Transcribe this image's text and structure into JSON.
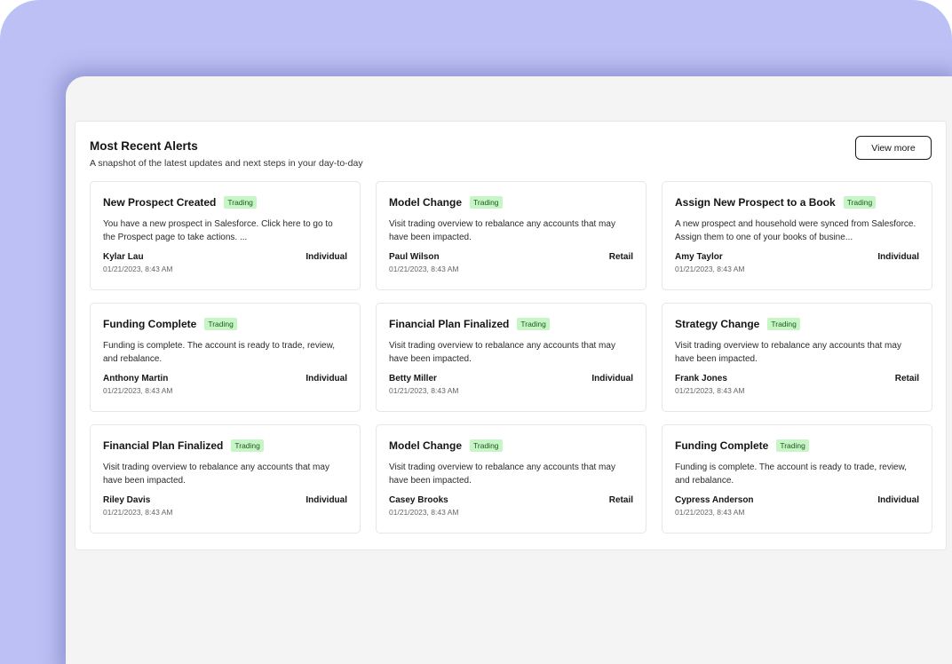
{
  "alerts_panel": {
    "title": "Most Recent Alerts",
    "subtitle": "A snapshot of the latest updates and next steps in your day-to-day",
    "view_more_label": "View more",
    "cards": [
      {
        "title": "New Prospect Created",
        "badge": "Trading",
        "description": "You have a new prospect in Salesforce. Click here to go to the Prospect page to take actions. ...",
        "name": "Kylar Lau",
        "type": "Individual",
        "date": "01/21/2023, 8:43 AM"
      },
      {
        "title": "Model Change",
        "badge": "Trading",
        "description": "Visit trading overview to rebalance any accounts that may have been impacted.",
        "name": "Paul Wilson",
        "type": "Retail",
        "date": "01/21/2023, 8:43 AM"
      },
      {
        "title": "Assign New Prospect to a Book",
        "badge": "Trading",
        "description": "A new prospect and household were synced from Salesforce. Assign them to one of your books of busine...",
        "name": "Amy Taylor",
        "type": "Individual",
        "date": "01/21/2023, 8:43 AM"
      },
      {
        "title": "Funding Complete",
        "badge": "Trading",
        "description": "Funding is complete. The account is ready to trade, review, and rebalance.",
        "name": "Anthony Martin",
        "type": "Individual",
        "date": "01/21/2023, 8:43 AM"
      },
      {
        "title": "Financial Plan Finalized",
        "badge": "Trading",
        "description": "Visit trading overview to rebalance any accounts that may have been impacted.",
        "name": "Betty Miller",
        "type": "Individual",
        "date": "01/21/2023, 8:43 AM"
      },
      {
        "title": "Strategy Change",
        "badge": "Trading",
        "description": "Visit trading overview to rebalance any accounts that may have been impacted.",
        "name": "Frank Jones",
        "type": "Retail",
        "date": "01/21/2023, 8:43 AM"
      },
      {
        "title": "Financial Plan Finalized",
        "badge": "Trading",
        "description": "Visit trading overview to rebalance any accounts that may have been impacted.",
        "name": "Riley Davis",
        "type": "Individual",
        "date": "01/21/2023, 8:43 AM"
      },
      {
        "title": "Model Change",
        "badge": "Trading",
        "description": "Visit trading overview to rebalance any accounts that may have been impacted.",
        "name": "Casey Brooks",
        "type": "Retail",
        "date": "01/21/2023, 8:43 AM"
      },
      {
        "title": "Funding Complete",
        "badge": "Trading",
        "description": "Funding is complete. The account is ready to trade, review, and rebalance.",
        "name": "Cypress Anderson",
        "type": "Individual",
        "date": "01/21/2023, 8:43 AM"
      }
    ]
  },
  "colors": {
    "background_frame": "#bcc0f4",
    "screen": "#f4f4f4",
    "badge_bg": "#c8f5c6",
    "badge_text": "#1b5a1f"
  }
}
